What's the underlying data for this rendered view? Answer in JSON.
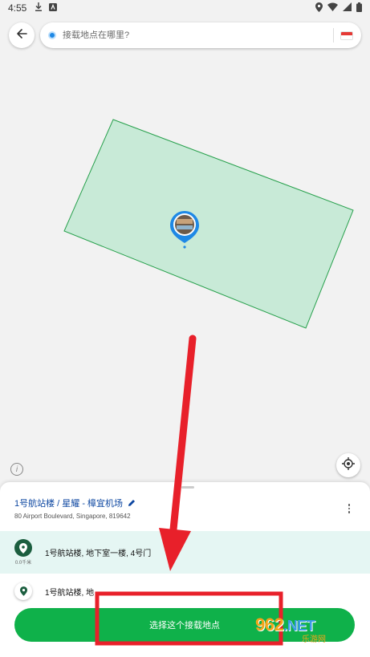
{
  "status_bar": {
    "time": "4:55"
  },
  "search": {
    "placeholder": "接载地点在哪里?"
  },
  "sheet": {
    "place_name": "1号航站楼 / 星耀 - 樟宜机场",
    "address": "80 Airport Boulevard, Singapore, 819642",
    "options": [
      {
        "label": "1号航站楼, 地下室一楼, 4号门",
        "distance": "0.0千米",
        "selected": true
      },
      {
        "label": "1号航站楼, 地",
        "distance": "",
        "selected": false
      }
    ],
    "cta_label": "选择这个接载地点"
  },
  "watermark": {
    "main": "962",
    "suffix": ".NET",
    "sub": "乐游网"
  },
  "colors": {
    "accent_green": "#0fb14a",
    "polygon_fill": "#c8ead7",
    "polygon_stroke": "#27a04c",
    "annotation_red": "#e8202a",
    "link_blue": "#0d47a1"
  }
}
